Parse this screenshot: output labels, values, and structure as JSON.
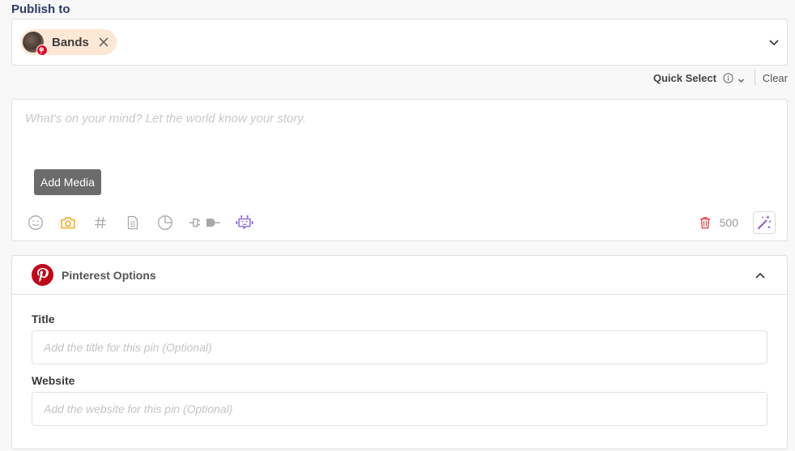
{
  "publish": {
    "label": "Publish to",
    "selected_accounts": [
      {
        "name": "Bands",
        "platform": "pinterest",
        "remove_icon": "close-icon"
      }
    ],
    "dropdown_icon": "chevron-down-icon"
  },
  "quick_select": {
    "label": "Quick Select",
    "info_icon": "info-icon",
    "chevron_icon": "chevron-down-icon",
    "clear_label": "Clear"
  },
  "composer": {
    "placeholder": "What's on your mind? Let the world know your story.",
    "value": "",
    "add_media_label": "Add Media",
    "toolbar_icons": [
      "emoji-icon",
      "camera-icon",
      "hashtag-icon",
      "document-icon",
      "pie-chart-icon",
      "plug-icon",
      "robot-icon"
    ],
    "char_count": "500",
    "delete_icon": "trash-icon",
    "ai_icon": "magic-wand-icon"
  },
  "pinterest_options": {
    "title": "Pinterest Options",
    "expanded": true,
    "fields": [
      {
        "label": "Title",
        "placeholder": "Add the title for this pin (Optional)",
        "value": ""
      },
      {
        "label": "Website",
        "placeholder": "Add the website for this pin (Optional)",
        "value": ""
      }
    ]
  },
  "colors": {
    "heading": "#2b3a67",
    "chip_bg": "#fde8d6",
    "pinterest_red": "#e60023",
    "camera_orange": "#f5a623",
    "robot_purple": "#8a63d2",
    "trash_red": "#e5484d"
  }
}
